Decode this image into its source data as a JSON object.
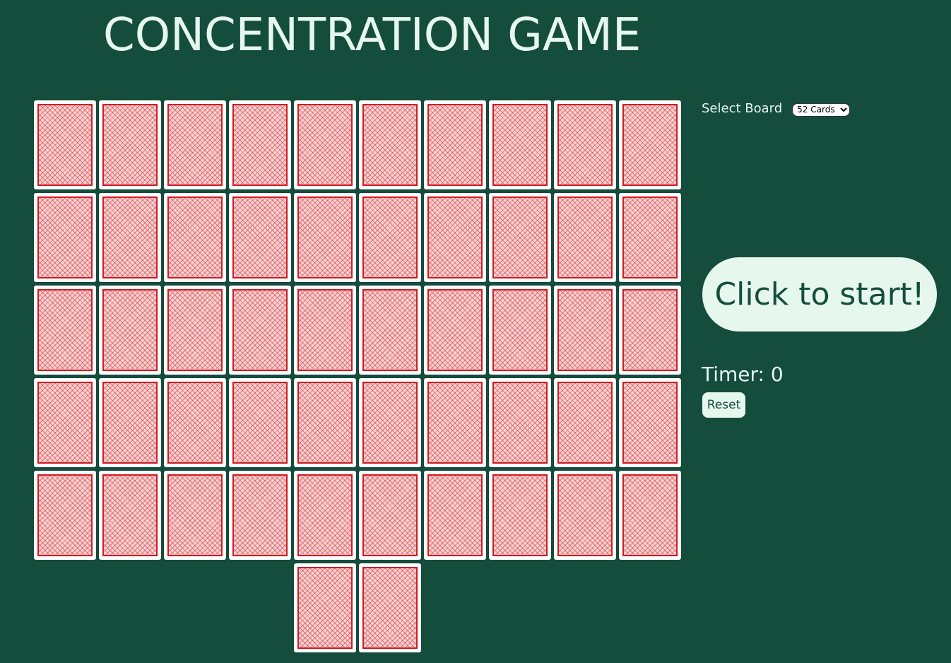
{
  "title": "CONCENTRATION GAME",
  "board": {
    "select_label": "Select Board",
    "options": [
      "52 Cards"
    ],
    "selected": "52 Cards",
    "card_count": 52,
    "columns": 10,
    "last_row_offset_columns": 4,
    "card_state": "face-down"
  },
  "start_button": "Click to start!",
  "timer": {
    "label": "Timer: ",
    "value": 0,
    "text": "Timer: 0"
  },
  "reset_button": "Reset",
  "colors": {
    "background": "#154d3d",
    "text_light": "#e6f7ee",
    "card_back_red": "#d01c24",
    "button_bg": "#e6f7ee",
    "button_text": "#154d3d"
  }
}
